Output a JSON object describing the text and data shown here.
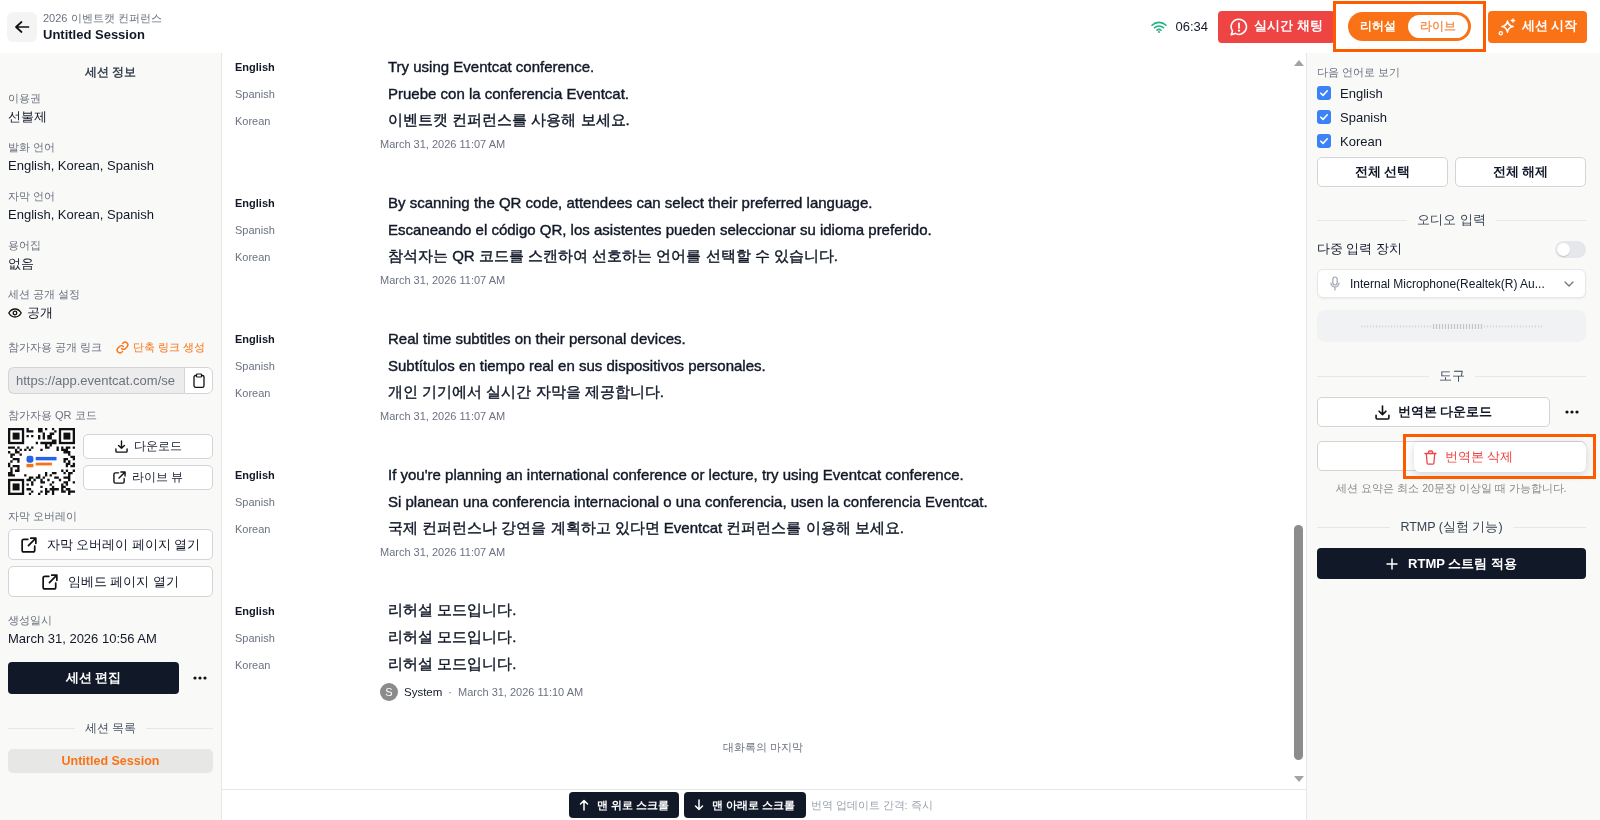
{
  "header": {
    "event_name": "2026 이벤트캣 컨퍼런스",
    "session_title": "Untitled Session",
    "clock": "06:34",
    "chat_button": "실시간 채팅",
    "mode_toggle": {
      "highlighted": true,
      "options": [
        {
          "label": "리허설",
          "selected": false
        },
        {
          "label": "라이브",
          "selected": true
        }
      ]
    },
    "start_button": "세션 시작"
  },
  "sidebar": {
    "title": "세션 정보",
    "fields": [
      {
        "kind": "text",
        "label": "이용권",
        "value": "선불제"
      },
      {
        "kind": "text",
        "label": "발화 언어",
        "value": "English, Korean, Spanish"
      },
      {
        "kind": "text",
        "label": "자막 언어",
        "value": "English, Korean, Spanish"
      },
      {
        "kind": "text",
        "label": "용어집",
        "value": "없음"
      },
      {
        "kind": "visibility",
        "label": "세션 공개 설정",
        "value": "공개"
      }
    ],
    "public_link": {
      "label": "참가자용 공개 링크",
      "shorten_link": "단축 링크 생성",
      "url": "https://app.eventcat.com/se"
    },
    "qr_code": {
      "label": "참가자용 QR 코드",
      "buttons": [
        {
          "kind": "download",
          "label": "다운로드"
        },
        {
          "kind": "external",
          "label": "라이브 뷰"
        }
      ]
    },
    "overlay": {
      "label": "자막 오버레이",
      "buttons": [
        {
          "kind": "external",
          "label": "자막 오버레이 페이지 열기"
        },
        {
          "kind": "external",
          "label": "임베드 페이지 열기"
        }
      ]
    },
    "created": {
      "label": "생성일시",
      "value": "March 31, 2026 10:56 AM"
    },
    "edit_button": "세션 편집",
    "session_list": {
      "title": "세션 목록",
      "items": [
        {
          "label": "Untitled Session",
          "selected": true
        }
      ]
    }
  },
  "transcript": {
    "blocks": [
      {
        "lines": [
          {
            "language": "English",
            "source": true,
            "text": "Try using Eventcat conference."
          },
          {
            "language": "Spanish",
            "source": false,
            "text": "Pruebe con la conferencia Eventcat."
          },
          {
            "language": "Korean",
            "source": false,
            "text": "이벤트캣 컨퍼런스를 사용해 보세요."
          }
        ],
        "time": "March 31, 2026 11:07 AM"
      },
      {
        "lines": [
          {
            "language": "English",
            "source": true,
            "text": "By scanning the QR code, attendees can select their preferred language."
          },
          {
            "language": "Spanish",
            "source": false,
            "text": "Escaneando el código QR, los asistentes pueden seleccionar su idioma preferido."
          },
          {
            "language": "Korean",
            "source": false,
            "text": "참석자는 QR 코드를 스캔하여 선호하는 언어를 선택할 수 있습니다."
          }
        ],
        "time": "March 31, 2026 11:07 AM"
      },
      {
        "lines": [
          {
            "language": "English",
            "source": true,
            "text": "Real time subtitles on their personal devices."
          },
          {
            "language": "Spanish",
            "source": false,
            "text": "Subtítulos en tiempo real en sus dispositivos personales."
          },
          {
            "language": "Korean",
            "source": false,
            "text": "개인 기기에서 실시간 자막을 제공합니다."
          }
        ],
        "time": "March 31, 2026 11:07 AM"
      },
      {
        "lines": [
          {
            "language": "English",
            "source": true,
            "text": "If you're planning an international conference or lecture, try using Eventcat conference."
          },
          {
            "language": "Spanish",
            "source": false,
            "text": "Si planean una conferencia internacional o una conferencia, usen la conferencia Eventcat."
          },
          {
            "language": "Korean",
            "source": false,
            "text": "국제 컨퍼런스나 강연을 계획하고 있다면 Eventcat 컨퍼런스를 이용해 보세요."
          }
        ],
        "time": "March 31, 2026 11:07 AM"
      },
      {
        "lines": [
          {
            "language": "English",
            "source": true,
            "text": "리허설 모드입니다."
          },
          {
            "language": "Spanish",
            "source": false,
            "text": "리허설 모드입니다."
          },
          {
            "language": "Korean",
            "source": false,
            "text": "리허설 모드입니다."
          }
        ],
        "speaker": {
          "initial": "S",
          "name": "System",
          "separator": "·"
        },
        "time": "March 31, 2026 11:10 AM"
      }
    ],
    "end_label": "대화록의 마지막",
    "bottom_bar": {
      "buttons": [
        {
          "kind": "up",
          "label": "맨 위로 스크롤"
        },
        {
          "kind": "down",
          "label": "맨 아래로 스크롤"
        }
      ],
      "update_interval": "번역 업데이트 간격: 즉시"
    }
  },
  "panel": {
    "languages": {
      "label": "다음 언어로 보기",
      "items": [
        {
          "label": "English",
          "checked": true
        },
        {
          "label": "Spanish",
          "checked": true
        },
        {
          "label": "Korean",
          "checked": true
        }
      ],
      "buttons": [
        "전체 선택",
        "전체 해제"
      ]
    },
    "audio": {
      "title": "오디오 입력",
      "multi_device": {
        "label": "다중 입력 장치",
        "on": false
      },
      "device": "Internal Microphone(Realtek(R) Au..."
    },
    "tools": {
      "title": "도구",
      "download_button": "번역본 다운로드",
      "menu": {
        "highlighted": true,
        "items": [
          {
            "kind": "danger",
            "label": "번역본 삭제"
          }
        ]
      },
      "hint": "세션 요약은 최소 20문장 이상일 때 가능합니다."
    },
    "rtmp": {
      "title": "RTMP (실험 기능)",
      "button": "RTMP 스트림 적용"
    }
  }
}
